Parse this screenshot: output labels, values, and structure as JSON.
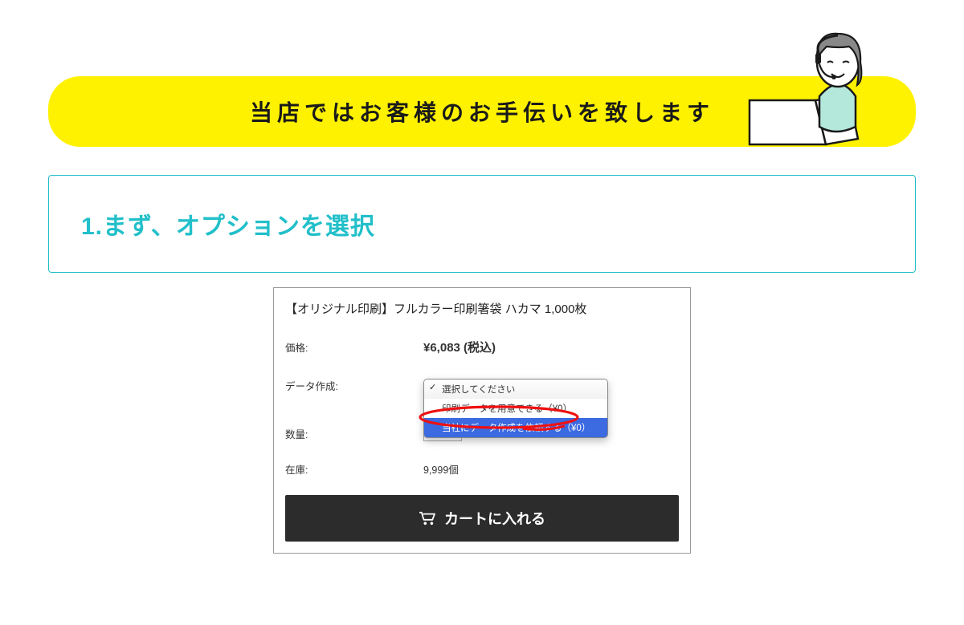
{
  "banner": {
    "text": "当店ではお客様のお手伝いを致します"
  },
  "step": {
    "title": "1.まず、オプションを選択"
  },
  "product": {
    "title": "【オリジナル印刷】フルカラー印刷箸袋 ハカマ 1,000枚",
    "rows": {
      "price_label": "価格:",
      "price_value": "¥6,083 (税込)",
      "data_label": "データ作成:",
      "qty_label": "数量:",
      "stock_label": "在庫:",
      "stock_value": "9,999個"
    },
    "dropdown": {
      "placeholder": "選択してください",
      "option_own": "印刷データを用意できる（¥0）",
      "option_request": "当社にデータ作成を依頼する（¥0）"
    },
    "cart_button_label": "カートに入れる"
  }
}
